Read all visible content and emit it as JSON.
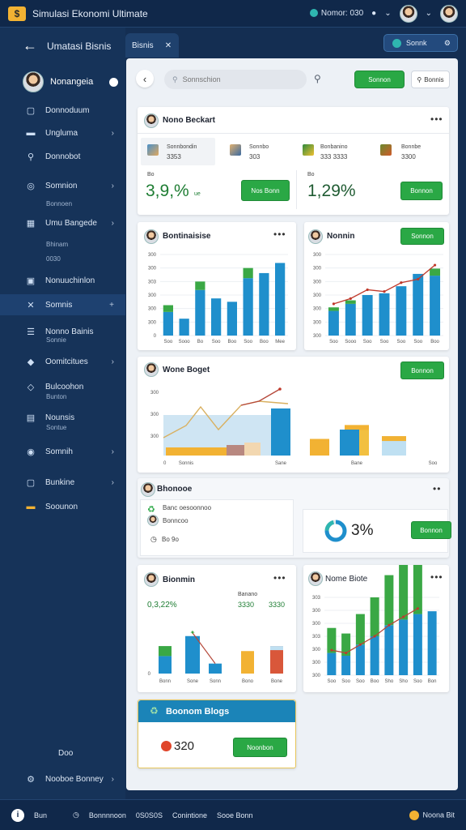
{
  "app": {
    "title": "Simulasi Ekonomi Ultimate"
  },
  "topbar": {
    "status_text": "Nomor: 030"
  },
  "sidebar": {
    "title": "Umatasi Bisnis",
    "user_name": "Nonangeia",
    "items": [
      {
        "label": "Donnoduum"
      },
      {
        "label": "Ungluma"
      },
      {
        "label": "Donnobot"
      },
      {
        "label": "Somnion"
      },
      {
        "label": "Umu Bangede"
      },
      {
        "label": "Nonuuchinlon"
      },
      {
        "label": "Somnis"
      },
      {
        "label": "Nonno Bainis"
      },
      {
        "label": "Oomitcitues"
      },
      {
        "label": "Bulcoohon"
      },
      {
        "label": "Nounsis"
      },
      {
        "label": "Somnih"
      },
      {
        "label": "Bunkine"
      },
      {
        "label": "Soounon"
      }
    ],
    "subs": {
      "s1": "Bonnoen",
      "s2": "Bhinam",
      "s3": "0030",
      "s4": "Sonnie",
      "s5": "Bunton",
      "s6": "Sontue"
    },
    "footer_label": "Doo",
    "footer_item": "Nooboe Bonney"
  },
  "tab": {
    "label": "Bisnis"
  },
  "top_action": {
    "label": "Sonnk"
  },
  "toolbar": {
    "search_placeholder": "Sonnschion",
    "primary_label": "Sonnon",
    "ghost_label": "Bonnis"
  },
  "card1": {
    "title": "Nono Beckart",
    "items": [
      {
        "name": "Sonnbondin",
        "value": "3353"
      },
      {
        "name": "Sonnbo",
        "value": "303"
      },
      {
        "name": "Bonbanino",
        "value": "333 3333"
      },
      {
        "name": "Bonnbe",
        "value": "3300"
      }
    ],
    "left_small": "Bo",
    "left_value": "3,9,%",
    "left_suffix": "ue",
    "left_button": "Nos Bonn",
    "right_small": "Bo",
    "right_value": "1,29%",
    "right_button": "Bonnon"
  },
  "card2": {
    "title": "Bontinaisise",
    "y_ticks": [
      "300",
      "300",
      "303",
      "300",
      "300",
      "300",
      "0"
    ],
    "x_labels": [
      "Soo",
      "Sooo",
      "Bo",
      "Soo",
      "Boo",
      "Soo",
      "Boo",
      "Mee"
    ]
  },
  "card3": {
    "title": "Nonnin",
    "button": "Sonnon",
    "y_ticks": [
      "300",
      "300",
      "300",
      "300",
      "300",
      "300",
      "300"
    ],
    "x_labels": [
      "Soo",
      "Sooo",
      "Soo",
      "Soo",
      "Soo",
      "Soo",
      "Boo"
    ]
  },
  "card4": {
    "title": "Wone Boget",
    "button": "Bonnon",
    "y_ticks": [
      "300",
      "300",
      "300"
    ],
    "x_labels": [
      "0",
      "Sonnis",
      "Sane",
      "Bane",
      "Soo"
    ]
  },
  "card5": {
    "title": "Bhonooe",
    "line1": "Banc oesoonnoo",
    "line2": "Bonncoo",
    "footer": "Bo 9o",
    "percent": "3%",
    "button": "Bonnon"
  },
  "card6": {
    "title": "Bionmin",
    "v1": "0,3,22%",
    "v2": "Banano",
    "v3": "3330",
    "v4": "3330",
    "x_labels": [
      "Bonn",
      "Sone",
      "Sonn",
      "Bono",
      "Bone"
    ],
    "y_zero": "0"
  },
  "card7": {
    "title": "Nome Biote",
    "y_ticks": [
      "303",
      "300",
      "300",
      "303",
      "300",
      "300",
      "300"
    ],
    "x_labels": [
      "Soo",
      "Soo",
      "Soo",
      "Boo",
      "Sho",
      "Sho",
      "Soo",
      "Bon"
    ]
  },
  "card8": {
    "title": "Boonom Blogs",
    "value": "320",
    "button": "Noonbon"
  },
  "bottombar": {
    "left_label": "Bun",
    "middle1": "Bonnnnoon",
    "middle2": "0S0S0S",
    "middle3": "Conintione",
    "middle4": "Sooe Bonn",
    "right_label": "Noona Bit"
  },
  "chart_data": [
    {
      "type": "bar",
      "categories": [
        "Soo",
        "Sooo",
        "Bo",
        "Soo",
        "Boo",
        "Soo",
        "Boo",
        "Mee"
      ],
      "series": [
        {
          "values": [
            70,
            50,
            135,
            110,
            100,
            170,
            185,
            215
          ]
        },
        {
          "values": [
            20,
            0,
            25,
            0,
            0,
            30,
            0,
            0
          ]
        }
      ],
      "ylim": [
        0,
        240
      ]
    },
    {
      "type": "bar",
      "categories": [
        "Soo",
        "Sooo",
        "Soo",
        "Soo",
        "Soo",
        "Soo",
        "Boo"
      ],
      "series": [
        {
          "values": [
            70,
            90,
            115,
            120,
            140,
            175,
            170
          ]
        },
        {
          "values": [
            10,
            10,
            0,
            0,
            0,
            0,
            20
          ]
        },
        {
          "values": [
            90,
            105,
            130,
            125,
            150,
            160,
            200
          ]
        }
      ],
      "ylim": [
        0,
        230
      ]
    },
    {
      "type": "bar",
      "categories": [
        "Sonnis",
        "Sane",
        "Bane",
        "Soo"
      ],
      "series": [
        {
          "values": [
            85,
            30,
            0,
            0
          ]
        },
        {
          "values": [
            0,
            0,
            55,
            35
          ]
        }
      ],
      "ylim": [
        0,
        120
      ]
    },
    {
      "type": "bar",
      "categories": [
        "Bonn",
        "Sone",
        "Sonn",
        "Bono",
        "Bone"
      ],
      "series": [
        {
          "values": [
            35,
            75,
            20,
            45,
            55
          ]
        },
        {
          "values": [
            20,
            0,
            0,
            0,
            0
          ]
        }
      ],
      "ylim": [
        0,
        120
      ]
    },
    {
      "type": "bar",
      "categories": [
        "Soo",
        "Soo",
        "Soo",
        "Boo",
        "Sho",
        "Sho",
        "Soo",
        "Bon"
      ],
      "series": [
        {
          "values": [
            40,
            35,
            55,
            70,
            90,
            100,
            110,
            115
          ]
        },
        {
          "values": [
            45,
            40,
            55,
            70,
            90,
            105,
            120,
            0
          ]
        }
      ],
      "ylim": [
        0,
        140
      ]
    }
  ]
}
